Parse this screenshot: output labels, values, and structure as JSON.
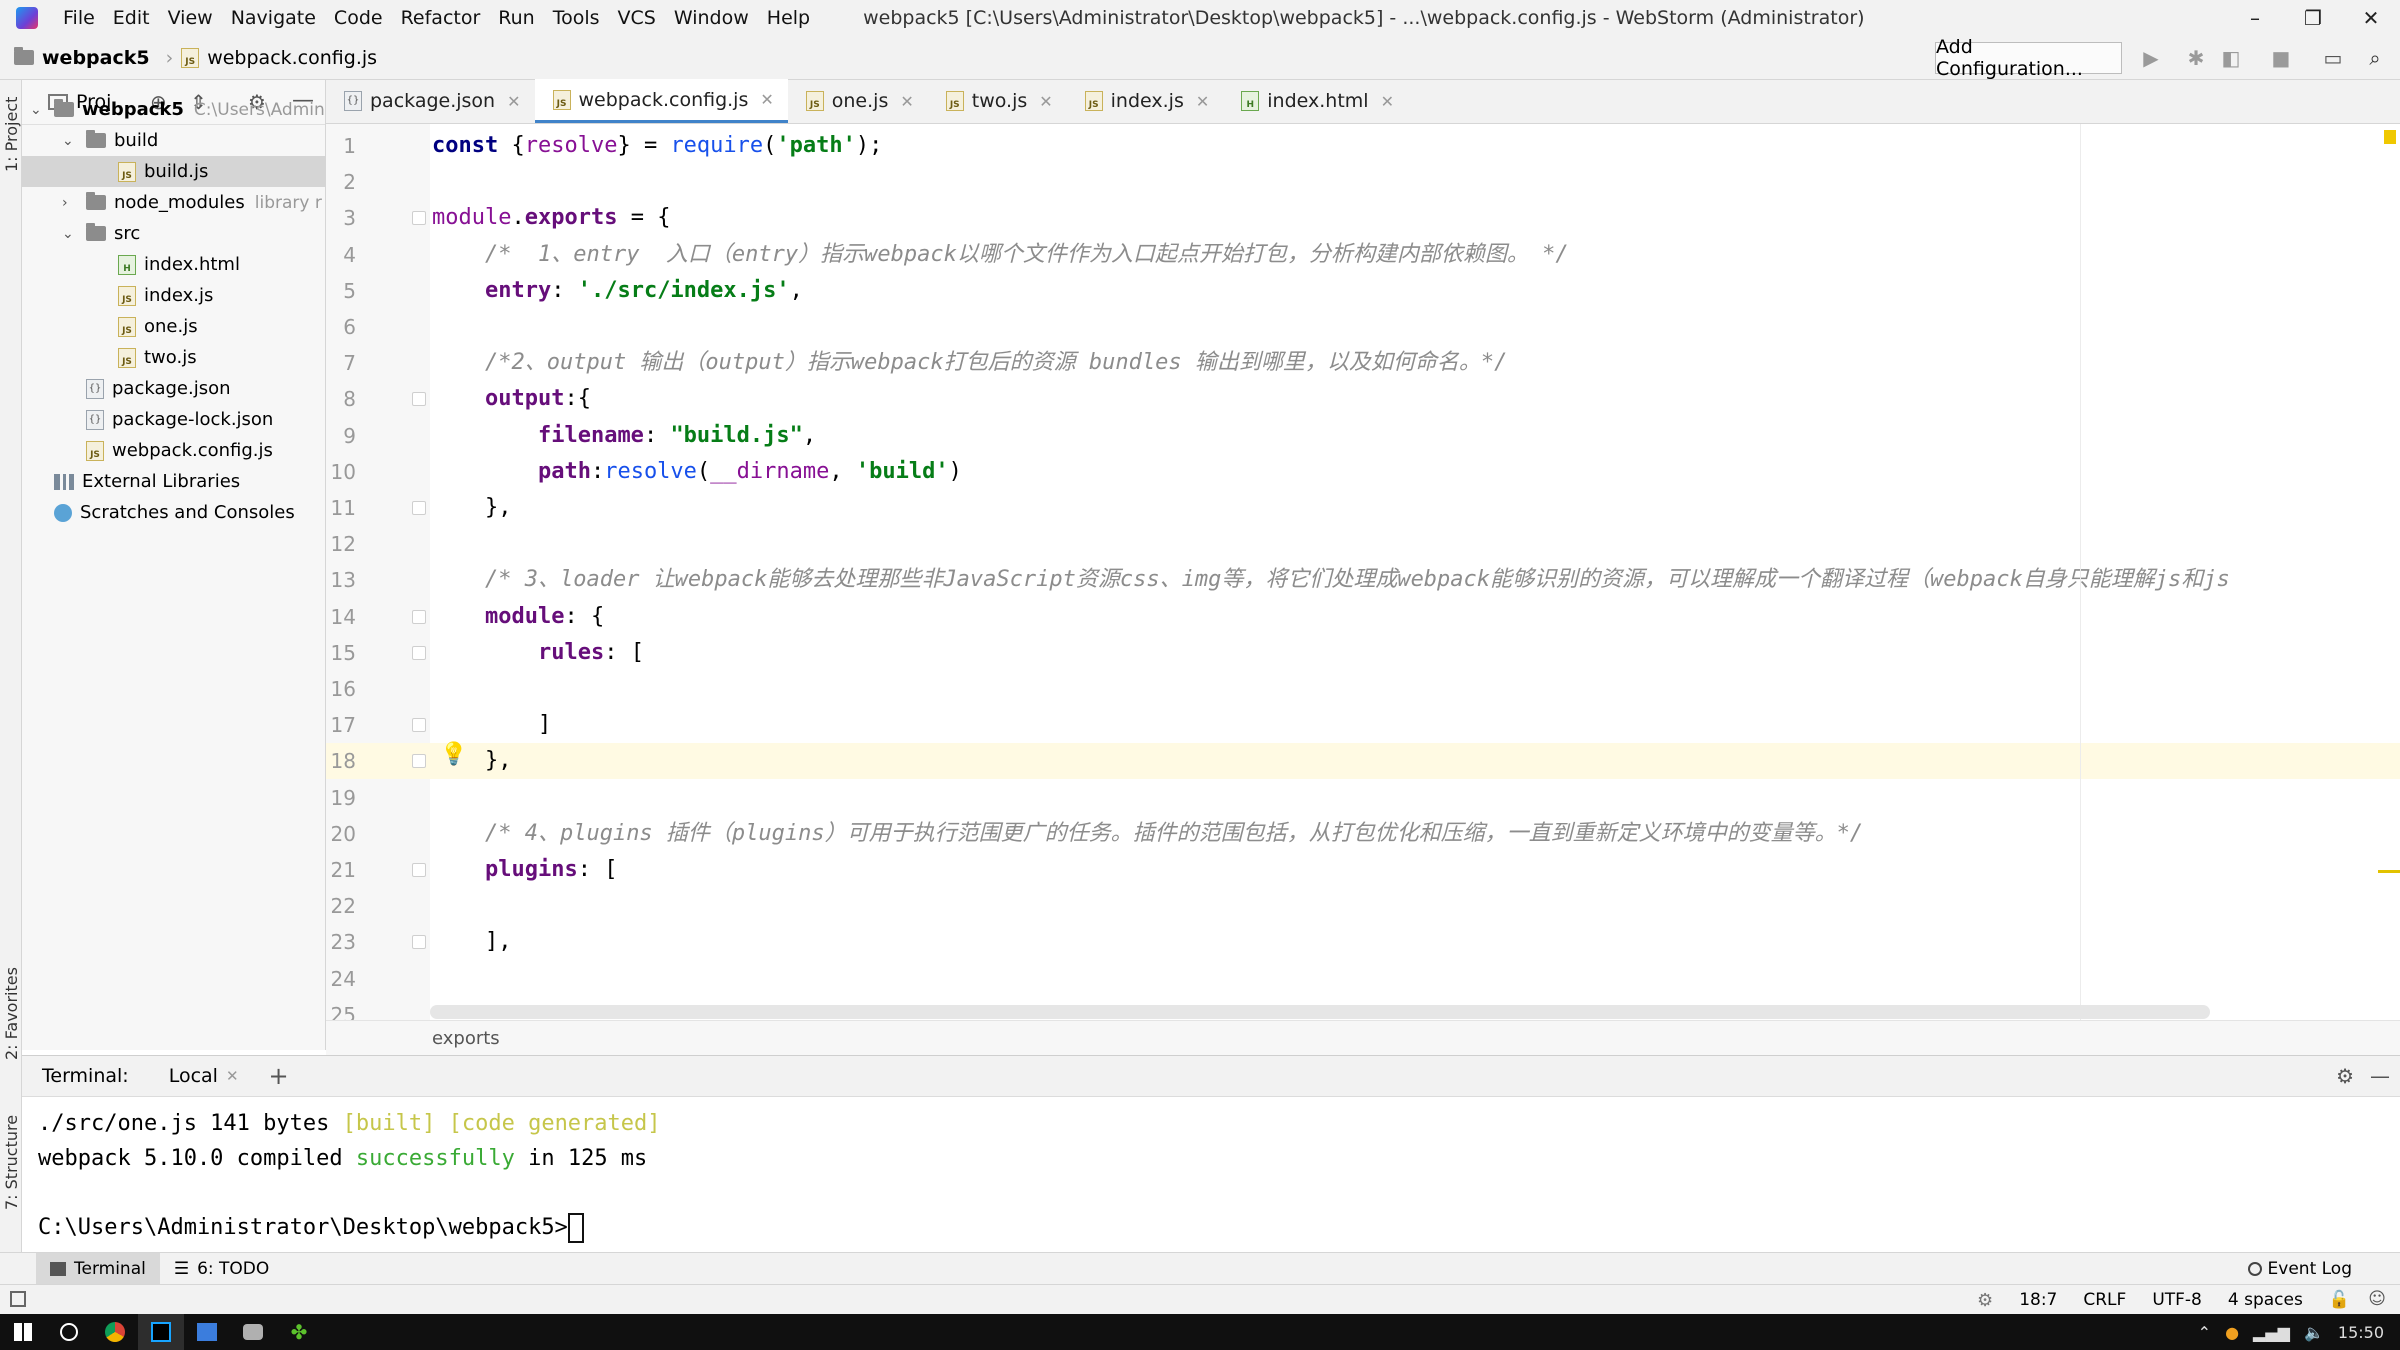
{
  "menu": {
    "items": [
      "File",
      "Edit",
      "View",
      "Navigate",
      "Code",
      "Refactor",
      "Run",
      "Tools",
      "VCS",
      "Window",
      "Help"
    ],
    "window_title": "webpack5 [C:\\Users\\Administrator\\Desktop\\webpack5] - ...\\webpack.config.js - WebStorm (Administrator)"
  },
  "nav": {
    "project": "webpack5",
    "file": "webpack.config.js",
    "add_configuration": "Add Configuration..."
  },
  "left_strip": {
    "project": "1: Project",
    "favorites": "2: Favorites",
    "structure": "7: Structure"
  },
  "project_panel": {
    "label": "Proj...",
    "tree": [
      {
        "label": "webpack5",
        "hint": "C:\\Users\\Admin",
        "type": "folder",
        "depth": 0,
        "expanded": true,
        "bold": true
      },
      {
        "label": "build",
        "type": "folder",
        "depth": 1,
        "expanded": true
      },
      {
        "label": "build.js",
        "type": "js",
        "depth": 2,
        "selected": true
      },
      {
        "label": "node_modules",
        "hint": "library r",
        "type": "folder",
        "depth": 1,
        "expanded": false
      },
      {
        "label": "src",
        "type": "folder",
        "depth": 1,
        "expanded": true
      },
      {
        "label": "index.html",
        "type": "html",
        "depth": 2
      },
      {
        "label": "index.js",
        "type": "js",
        "depth": 2
      },
      {
        "label": "one.js",
        "type": "js",
        "depth": 2
      },
      {
        "label": "two.js",
        "type": "js",
        "depth": 2
      },
      {
        "label": "package.json",
        "type": "json",
        "depth": 1
      },
      {
        "label": "package-lock.json",
        "type": "json",
        "depth": 1
      },
      {
        "label": "webpack.config.js",
        "type": "js",
        "depth": 1
      },
      {
        "label": "External Libraries",
        "type": "lib",
        "depth": 0
      },
      {
        "label": "Scratches and Consoles",
        "type": "scratch",
        "depth": 0
      }
    ]
  },
  "tabs": [
    {
      "label": "package.json",
      "type": "json",
      "active": false
    },
    {
      "label": "webpack.config.js",
      "type": "js",
      "active": true
    },
    {
      "label": "one.js",
      "type": "js",
      "active": false
    },
    {
      "label": "two.js",
      "type": "js",
      "active": false
    },
    {
      "label": "index.js",
      "type": "js",
      "active": false
    },
    {
      "label": "index.html",
      "type": "html",
      "active": false
    }
  ],
  "editor": {
    "current_line": 18,
    "lines": [
      [
        [
          "kw",
          "const "
        ],
        [
          "",
          "{"
        ],
        [
          "var",
          "resolve"
        ],
        [
          "",
          "} = "
        ],
        [
          "fn",
          "require"
        ],
        [
          "",
          "("
        ],
        [
          "str",
          "'path'"
        ],
        [
          "",
          ");"
        ]
      ],
      [],
      [
        [
          "var",
          "module"
        ],
        [
          "",
          "."
        ],
        [
          "prop",
          "exports"
        ],
        [
          "",
          " = {"
        ]
      ],
      [
        [
          "",
          "    "
        ],
        [
          "cmt",
          "/*  1、entry  入口（entry）指示webpack以哪个文件作为入口起点开始打包，分析构建内部依赖图。 */"
        ]
      ],
      [
        [
          "",
          "    "
        ],
        [
          "prop",
          "entry"
        ],
        [
          "",
          ": "
        ],
        [
          "str",
          "'./src/index.js'"
        ],
        [
          "",
          ","
        ]
      ],
      [],
      [
        [
          "",
          "    "
        ],
        [
          "cmt",
          "/*2、output 输出（output）指示webpack打包后的资源 bundles 输出到哪里，以及如何命名。*/"
        ]
      ],
      [
        [
          "",
          "    "
        ],
        [
          "prop",
          "output"
        ],
        [
          "",
          ":{"
        ]
      ],
      [
        [
          "",
          "        "
        ],
        [
          "prop",
          "filename"
        ],
        [
          "",
          ": "
        ],
        [
          "str",
          "\"build.js\""
        ],
        [
          "",
          ","
        ]
      ],
      [
        [
          "",
          "        "
        ],
        [
          "prop",
          "path"
        ],
        [
          "",
          ":"
        ],
        [
          "fn",
          "resolve"
        ],
        [
          "",
          "("
        ],
        [
          "var",
          "__dirname"
        ],
        [
          "",
          ", "
        ],
        [
          "str",
          "'build'"
        ],
        [
          "",
          ")"
        ]
      ],
      [
        [
          "",
          "    },"
        ]
      ],
      [],
      [
        [
          "",
          "    "
        ],
        [
          "cmt",
          "/* 3、loader 让webpack能够去处理那些非JavaScript资源css、img等，将它们处理成webpack能够识别的资源，可以理解成一个翻译过程（webpack自身只能理解js和js"
        ]
      ],
      [
        [
          "",
          "    "
        ],
        [
          "prop",
          "module"
        ],
        [
          "",
          ": {"
        ]
      ],
      [
        [
          "",
          "        "
        ],
        [
          "prop",
          "rules"
        ],
        [
          "",
          ": ["
        ]
      ],
      [],
      [
        [
          "",
          "        ]"
        ]
      ],
      [
        [
          "",
          "    },"
        ]
      ],
      [],
      [
        [
          "",
          "    "
        ],
        [
          "cmt",
          "/* 4、plugins 插件（plugins）可用于执行范围更广的任务。插件的范围包括，从打包优化和压缩，一直到重新定义环境中的变量等。*/"
        ]
      ],
      [
        [
          "",
          "    "
        ],
        [
          "prop",
          "plugins"
        ],
        [
          "",
          ": ["
        ]
      ],
      [],
      [
        [
          "",
          "    ],"
        ]
      ],
      [],
      []
    ],
    "breadcrumb": "exports"
  },
  "terminal": {
    "title": "Terminal:",
    "tab": "Local",
    "plus": "+",
    "lines": [
      [
        [
          "",
          "./src/one.js 141 bytes "
        ],
        [
          "y",
          "[built] [code generated]"
        ]
      ],
      [
        [
          "",
          "webpack 5.10.0 compiled "
        ],
        [
          "g",
          "successfully"
        ],
        [
          "",
          " in 125 ms"
        ]
      ],
      [],
      [
        [
          "",
          "C:\\Users\\Administrator\\Desktop\\webpack5>"
        ]
      ]
    ]
  },
  "tool_windows": {
    "terminal": "Terminal",
    "todo": "6: TODO",
    "event_log": "Event Log"
  },
  "status": {
    "position": "18:7",
    "line_sep": "CRLF",
    "encoding": "UTF-8",
    "indent": "4 spaces"
  },
  "taskbar": {
    "time": "15:50"
  },
  "colors": {
    "accent": "#4083c9",
    "keyword": "#000080",
    "property": "#660e7a",
    "string": "#067d17",
    "comment": "#8c8c8c"
  }
}
